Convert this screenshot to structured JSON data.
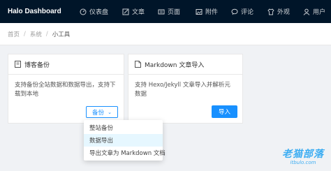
{
  "app": {
    "brand": "Halo  Dashboard"
  },
  "nav": {
    "items": [
      {
        "label": "仪表盘",
        "icon": "dashboard-icon"
      },
      {
        "label": "文章",
        "icon": "edit-icon"
      },
      {
        "label": "页面",
        "icon": "page-icon"
      },
      {
        "label": "附件",
        "icon": "picture-icon"
      },
      {
        "label": "评论",
        "icon": "comment-icon"
      },
      {
        "label": "外观",
        "icon": "skin-icon"
      },
      {
        "label": "用户",
        "icon": "user-icon"
      }
    ]
  },
  "breadcrumb": {
    "home": "首页",
    "system": "系统",
    "current": "小工具",
    "separator": "/"
  },
  "backup_card": {
    "title": "博客备份",
    "description": "支持备份全站数据和数据导出，支持下载到本地",
    "button": "备份"
  },
  "markdown_card": {
    "title": "Markdown 文章导入",
    "description": "支持 Hexo/Jekyll 文章导入并解析元数据",
    "button": "导入"
  },
  "dropdown": {
    "items": [
      "整站备份",
      "数据导出",
      "导出文章为 Markdown 文档"
    ],
    "highlighted_index": 1
  },
  "watermark": {
    "main": "老猫部落",
    "sub": "itbulo.com"
  },
  "colors": {
    "topbar": "#001529",
    "primary": "#1890ff",
    "background": "#f0f2f5",
    "highlight": "#e6f7ff"
  }
}
